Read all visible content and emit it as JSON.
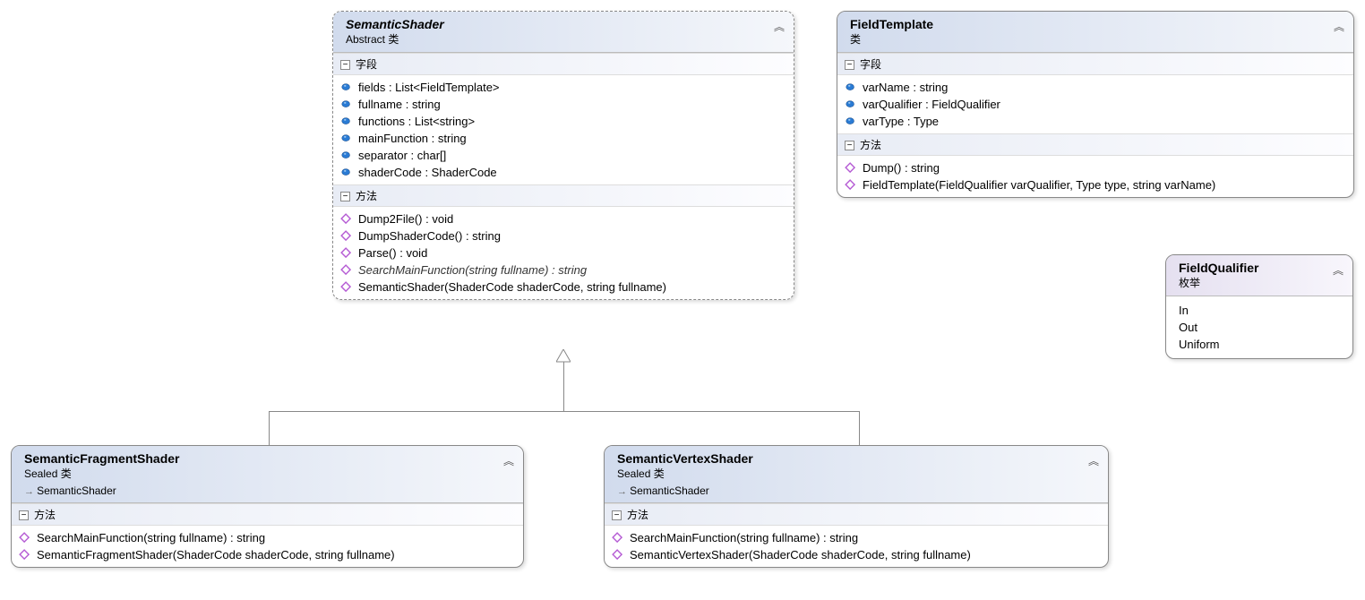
{
  "semanticShader": {
    "title": "SemanticShader",
    "subtitle": "Abstract 类",
    "sections": {
      "fields": {
        "label": "字段",
        "items": [
          "fields : List<FieldTemplate>",
          "fullname : string",
          "functions : List<string>",
          "mainFunction : string",
          "separator : char[]",
          "shaderCode : ShaderCode"
        ]
      },
      "methods": {
        "label": "方法",
        "items": [
          {
            "sig": "Dump2File() : void",
            "style": ""
          },
          {
            "sig": "DumpShaderCode() : string",
            "style": ""
          },
          {
            "sig": "Parse() : void",
            "style": ""
          },
          {
            "sig": "SearchMainFunction(string fullname) : string",
            "style": "italic"
          },
          {
            "sig": "SemanticShader(ShaderCode shaderCode, string fullname)",
            "style": ""
          }
        ]
      }
    }
  },
  "fieldTemplate": {
    "title": "FieldTemplate",
    "subtitle": "类",
    "sections": {
      "fields": {
        "label": "字段",
        "items": [
          "varName : string",
          "varQualifier : FieldQualifier",
          "varType : Type"
        ]
      },
      "methods": {
        "label": "方法",
        "items": [
          "Dump() : string",
          "FieldTemplate(FieldQualifier varQualifier, Type type, string varName)"
        ]
      }
    }
  },
  "fieldQualifier": {
    "title": "FieldQualifier",
    "subtitle": "枚举",
    "values": [
      "In",
      "Out",
      "Uniform"
    ]
  },
  "fragment": {
    "title": "SemanticFragmentShader",
    "subtitle": "Sealed 类",
    "inherits": "SemanticShader",
    "methods": {
      "label": "方法",
      "items": [
        "SearchMainFunction(string fullname) : string",
        "SemanticFragmentShader(ShaderCode shaderCode, string fullname)"
      ]
    }
  },
  "vertex": {
    "title": "SemanticVertexShader",
    "subtitle": "Sealed 类",
    "inherits": "SemanticShader",
    "methods": {
      "label": "方法",
      "items": [
        "SearchMainFunction(string fullname) : string",
        "SemanticVertexShader(ShaderCode shaderCode, string fullname)"
      ]
    }
  }
}
